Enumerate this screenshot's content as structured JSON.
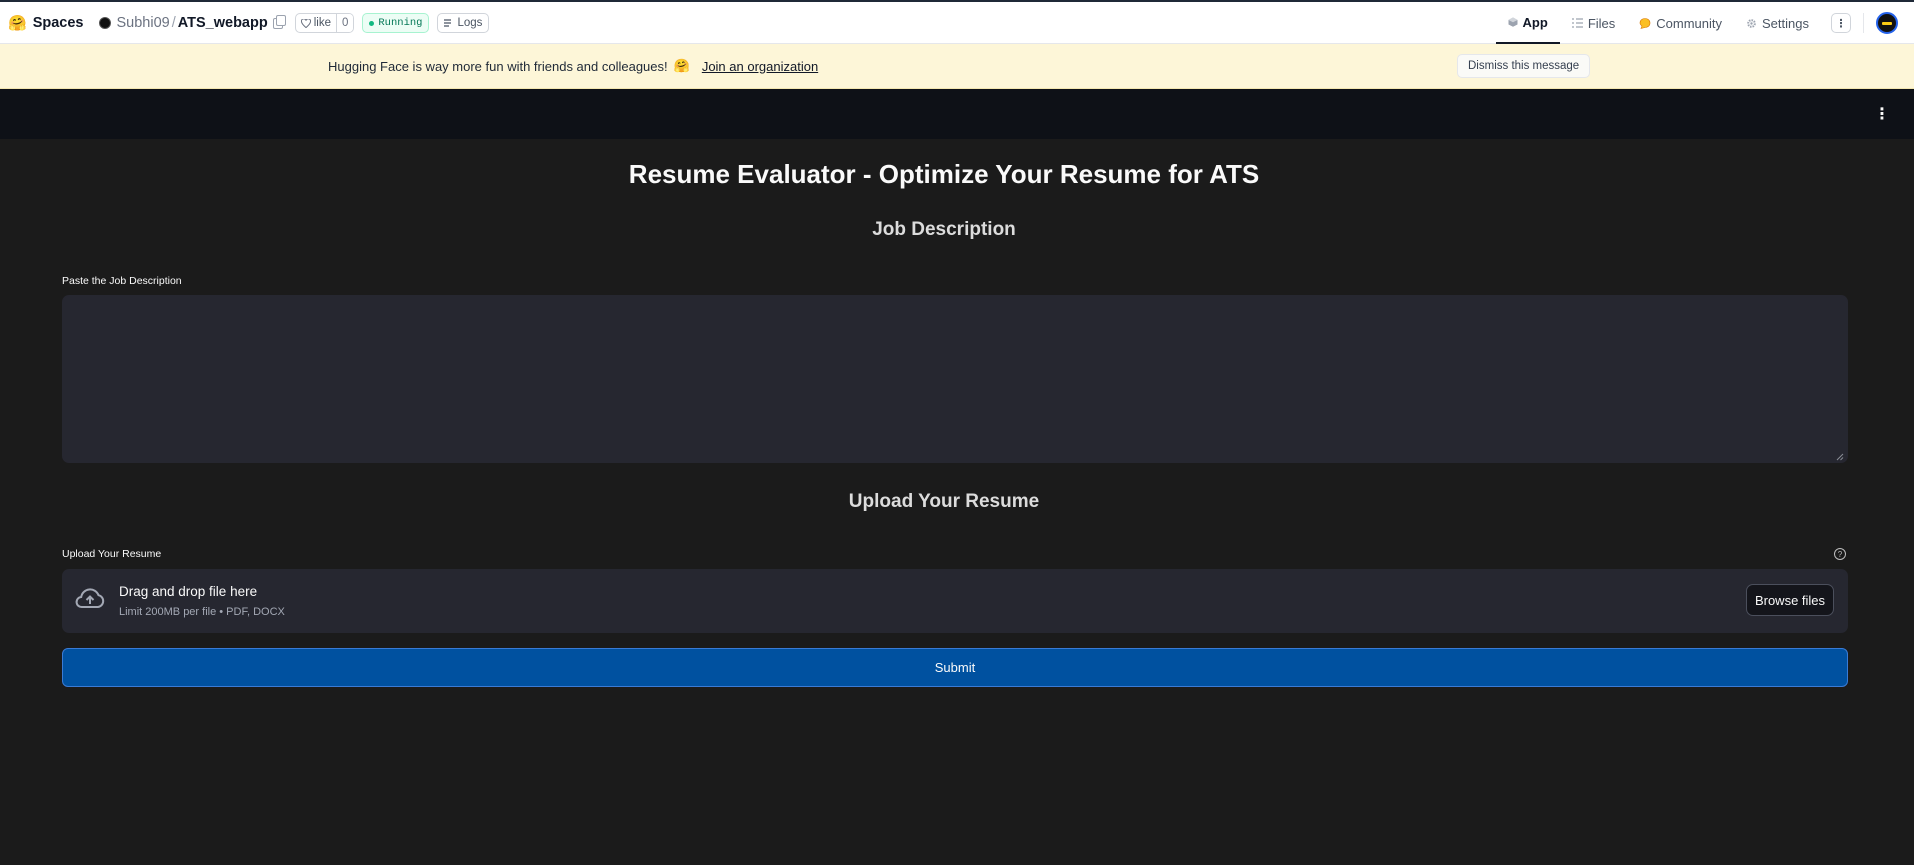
{
  "hf_header": {
    "logo_glyph": "🤗",
    "spaces_label": "Spaces",
    "owner": "Subhi09",
    "separator": "/",
    "repo_name": "ATS_webapp",
    "like_label": "like",
    "like_count": "0",
    "status": "Running",
    "logs_label": "Logs",
    "tabs": [
      {
        "label": "App",
        "icon": "app-cube-icon",
        "active": true
      },
      {
        "label": "Files",
        "icon": "files-icon",
        "active": false
      },
      {
        "label": "Community",
        "icon": "community-icon",
        "active": false
      },
      {
        "label": "Settings",
        "icon": "gear-icon",
        "active": false
      }
    ],
    "more_glyph": "⋮"
  },
  "banner": {
    "message": "Hugging Face is way more fun with friends and colleagues!",
    "emoji": "🤗",
    "link_text": "Join an organization",
    "dismiss_label": "Dismiss this message"
  },
  "app": {
    "menu_glyph": "⋮",
    "title": "Resume Evaluator - Optimize Your Resume for ATS",
    "section_job": "Job Description",
    "job_input_label": "Paste the Job Description",
    "job_input_value": "",
    "section_upload": "Upload Your Resume",
    "upload_label": "Upload Your Resume",
    "help_glyph": "?",
    "dropzone_title": "Drag and drop file here",
    "dropzone_sub": "Limit 200MB per file • PDF, DOCX",
    "browse_label": "Browse files",
    "submit_label": "Submit"
  },
  "colors": {
    "app_bg": "#1b1b1b",
    "header_bg": "#0e1117",
    "widget_bg": "#262730",
    "submit_bg": "#0051a0",
    "banner_bg": "#fdf6d8",
    "running_green": "#10b981"
  }
}
